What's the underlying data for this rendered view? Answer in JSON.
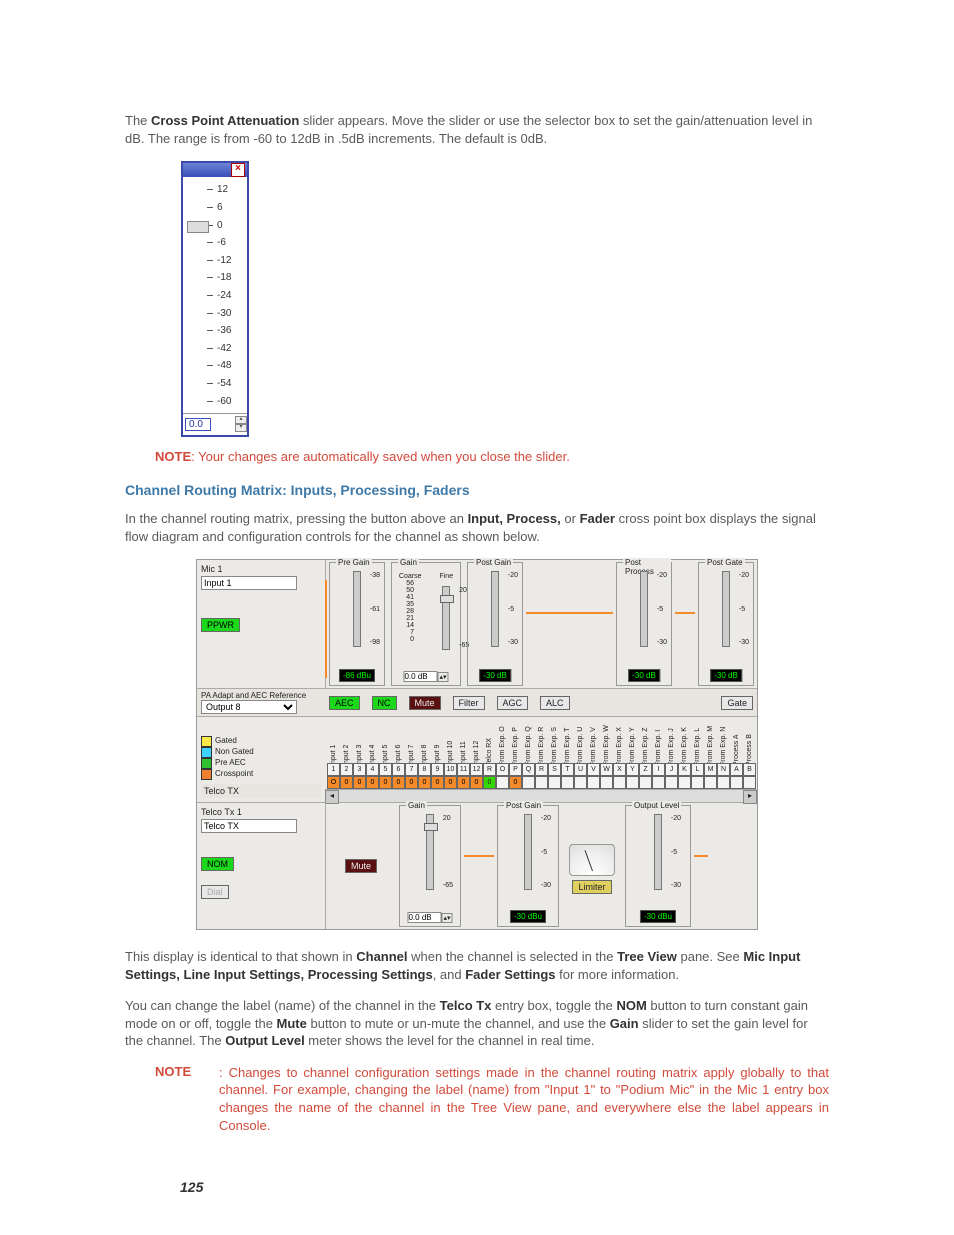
{
  "intro": {
    "pre": "The ",
    "b1": "Cross Point Attenuation",
    "post": " slider appears. Move the slider or use the selector box to set the gain/attenuation level in dB. The range is from -60 to 12dB in .5dB increments. The default is 0dB."
  },
  "slider": {
    "close": "×",
    "ticks": [
      "12",
      "6",
      "0",
      "-6",
      "-12",
      "-18",
      "-24",
      "-30",
      "-36",
      "-42",
      "-48",
      "-54",
      "-60"
    ],
    "value": "0.0"
  },
  "note1": {
    "label": "NOTE",
    "text": ": Your changes are automatically saved when you close the slider."
  },
  "section_heading": "Channel Routing Matrix: Inputs, Processing, Faders",
  "para2": {
    "pre": "In the channel routing matrix, pressing the button above an ",
    "b1": "Input, Process,",
    "mid": " or ",
    "b2": "Fader",
    "post": " cross point box displays the signal flow diagram and configuration controls for the channel as shown below."
  },
  "matrix": {
    "mic_label": "Mic 1",
    "mic_input": "Input 1",
    "ppwr": "PPWR",
    "pregain": {
      "title": "Pre Gain",
      "hi": "-38",
      "lo": "-98",
      "mid_tick": "-61",
      "read": "-86 dBu"
    },
    "gain_coarse": {
      "title": "Gain",
      "sub": "Coarse",
      "ticks": [
        "56",
        "50",
        "41",
        "35",
        "28",
        "21",
        "14",
        "7",
        "0"
      ]
    },
    "gain_fine": {
      "title": "Fine",
      "hi": "20",
      "lo": "-65",
      "value": "0.0 dB"
    },
    "postgain": {
      "title": "Post Gain",
      "hi": "-20",
      "mid": "-5",
      "lo": "-30",
      "read": "-30 dB"
    },
    "postproc": {
      "title": "Post Process",
      "hi": "-20",
      "mid": "-5",
      "lo": "-30",
      "read": "-30 dB"
    },
    "postgate": {
      "title": "Post Gate",
      "hi": "-20",
      "mid": "-5",
      "lo": "-30",
      "read": "-30 dB"
    },
    "ref_label": "PA Adapt and AEC Reference",
    "ref_value": "Output 8",
    "buttons": {
      "aec": "AEC",
      "nc": "NC",
      "mute": "Mute",
      "filter": "Filter",
      "agc": "AGC",
      "alc": "ALC",
      "gate": "Gate"
    },
    "legend": {
      "gated": "Gated",
      "nongated": "Non Gated",
      "preaec": "Pre AEC",
      "cross": "Crosspoint",
      "colors": {
        "gated": "#f8e84a",
        "nongated": "#3ed0ff",
        "preaec": "#30c030",
        "cross": "#f08030"
      }
    },
    "cols": [
      "Input 1",
      "Input 2",
      "Input 3",
      "Input 4",
      "Input 5",
      "Input 6",
      "Input 7",
      "Input 8",
      "Input 9",
      "Input 10",
      "Input 11",
      "Input 12",
      "Telco RX",
      "From Exp. O",
      "From Exp. P",
      "From Exp. Q",
      "From Exp. R",
      "From Exp. S",
      "From Exp. T",
      "From Exp. U",
      "From Exp. V",
      "From Exp. W",
      "From Exp. X",
      "From Exp. Y",
      "From Exp. Z",
      "From Exp. I",
      "From Exp. J",
      "From Exp. K",
      "From Exp. L",
      "From Exp. M",
      "From Exp. N",
      "Process A",
      "Process B"
    ],
    "col_letters": [
      "1",
      "2",
      "3",
      "4",
      "5",
      "6",
      "7",
      "8",
      "9",
      "10",
      "11",
      "12",
      "R",
      "O",
      "P",
      "Q",
      "R",
      "S",
      "T",
      "U",
      "V",
      "W",
      "X",
      "Y",
      "Z",
      "I",
      "J",
      "K",
      "L",
      "M",
      "N",
      "A",
      "B"
    ],
    "row_label": "Telco TX",
    "row_cells": [
      "O",
      "0",
      "0",
      "0",
      "0",
      "0",
      "0",
      "0",
      "0",
      "0",
      "0",
      "0",
      "G",
      "",
      "0",
      "",
      "",
      "",
      "",
      "",
      "",
      "",
      "",
      "",
      "",
      "",
      "",
      "",
      "",
      "",
      "",
      "",
      ""
    ],
    "telco": {
      "lbl": "Telco Tx 1",
      "input": "Telco TX",
      "nom": "NOM",
      "dial": "Dial",
      "mute": "Mute",
      "gain_title": "Gain",
      "gain_hi": "20",
      "gain_lo": "-65",
      "gain_val": "0.0 dB",
      "postgain_title": "Post Gain",
      "pg_hi": "-20",
      "pg_mid": "-5",
      "pg_lo": "-30",
      "pg_read": "-30 dBu",
      "outlvl_title": "Output Level",
      "ol_hi": "-20",
      "ol_mid": "-5",
      "ol_lo": "-30",
      "ol_read": "-30 dBu",
      "limiter": "Limiter"
    }
  },
  "para3": {
    "pre": "This display is identical to that shown in ",
    "b1": "Channel",
    "mid1": " when the channel is selected in the ",
    "b2": "Tree View",
    "mid2": " pane. See ",
    "b3": "Mic Input Settings, Line Input Settings, Processing Settings",
    "mid3": ", and ",
    "b4": "Fader Settings",
    "post": " for more information."
  },
  "para4": {
    "pre": "You can change the label (name) of the channel in the ",
    "b1": "Telco Tx",
    "mid1": " entry box, toggle the ",
    "b2": "NOM",
    "mid2": " button to turn constant gain mode on or off, toggle the ",
    "b3": "Mute",
    "mid3": " button to mute or un-mute the channel, and use the ",
    "b4": "Gain",
    "mid4": " slider to set the gain level for the channel. The ",
    "b5": "Output Level",
    "post": " meter shows the level for the channel in real time."
  },
  "note2": {
    "label": "NOTE",
    "text": ": Changes to channel configuration settings made in the channel routing matrix apply globally to that channel. For example, changing the label (name) from \"Input 1\" to \"Podium Mic\" in the Mic 1 entry box changes the name of the channel in the Tree View pane, and everywhere else the label appears in Console."
  },
  "page_number": "125"
}
